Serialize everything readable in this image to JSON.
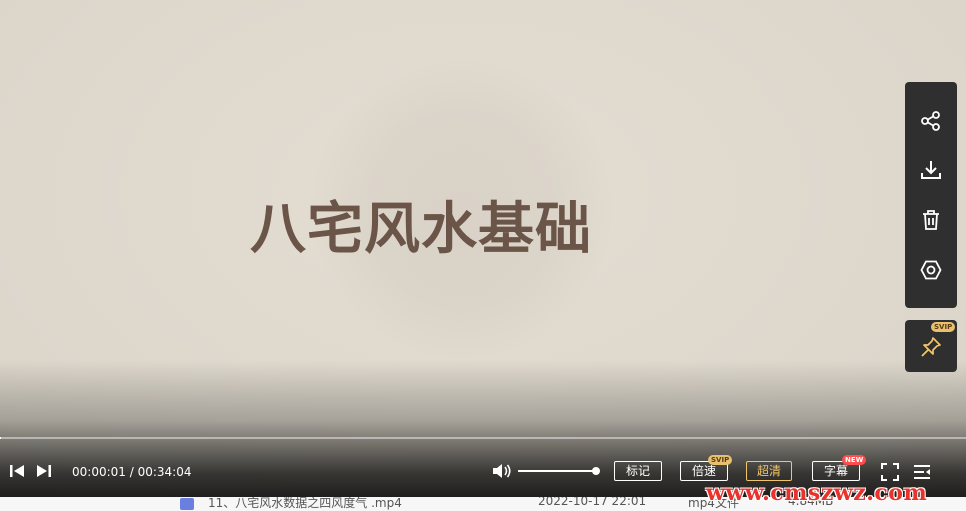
{
  "video": {
    "title": "八宅风水基础"
  },
  "player": {
    "current_time": "00:00:01",
    "separator": " / ",
    "duration": "00:34:04",
    "progress": 0.0005,
    "volume": 1.0
  },
  "buttons": {
    "mark": "标记",
    "speed": "倍速",
    "speed_tag": "SVIP",
    "quality": "超清",
    "subtitle": "字幕",
    "subtitle_tag": "NEW"
  },
  "side_panel": {
    "pin_tag": "SVIP",
    "icons": [
      "share-icon",
      "download-icon",
      "delete-icon",
      "settings-icon",
      "pin-icon"
    ]
  },
  "file_row": {
    "name": "11、八宅风水数据之四风度气 .mp4",
    "date": "2022-10-17 22:01",
    "type": "mp4文件",
    "size": "4.84MB"
  },
  "watermark": "www.cmszwz.com",
  "colors": {
    "title": "#6b5548",
    "gold": "#f1c66a",
    "new_badge": "#ff4d4f",
    "panel": "#2f2f2f",
    "watermark": "#e8322b"
  }
}
